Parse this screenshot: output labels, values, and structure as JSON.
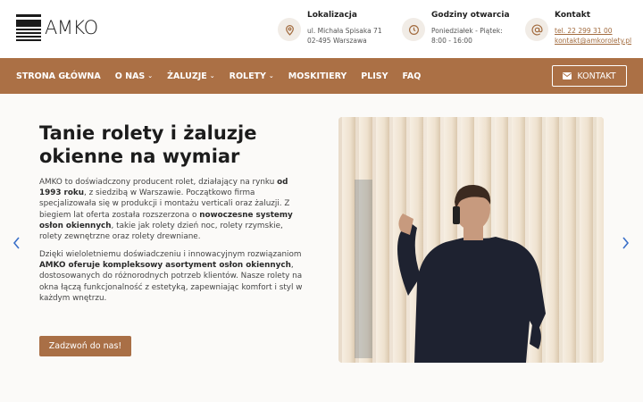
{
  "brand": {
    "name": "AMKO"
  },
  "header": {
    "location": {
      "title": "Lokalizacja",
      "line1": "ul. Michała Spisaka 71",
      "line2": "02-495 Warszawa",
      "icon": "map-pin-icon"
    },
    "hours": {
      "title": "Godziny otwarcia",
      "line1": "Poniedziałek - Piątek:",
      "line2": "8:00 - 16:00",
      "icon": "clock-icon"
    },
    "contact": {
      "title": "Kontakt",
      "phone": "tel. 22 299 31 00",
      "email": "kontakt@amkorolety.pl",
      "icon": "at-icon"
    }
  },
  "nav": {
    "items": [
      {
        "label": "STRONA GŁÓWNA",
        "dropdown": false
      },
      {
        "label": "O NAS",
        "dropdown": true
      },
      {
        "label": "ŻALUZJE",
        "dropdown": true
      },
      {
        "label": "ROLETY",
        "dropdown": true
      },
      {
        "label": "MOSKITIERY",
        "dropdown": false
      },
      {
        "label": "PLISY",
        "dropdown": false
      },
      {
        "label": "FAQ",
        "dropdown": false
      }
    ],
    "contact_button": "KONTAKT"
  },
  "hero": {
    "title": "Tanie rolety i żaluzje okienne na wymiar",
    "p1": [
      {
        "t": "AMKO to doświadczony producent rolet, działający na rynku ",
        "b": false
      },
      {
        "t": "od 1993 roku",
        "b": true
      },
      {
        "t": ", z siedzibą w Warszawie. Początkowo firma specjalizowała się w produkcji i montażu verticali oraz żaluzji. Z biegiem lat oferta została rozszerzona o ",
        "b": false
      },
      {
        "t": "nowoczesne systemy osłon okiennych",
        "b": true
      },
      {
        "t": ", takie jak rolety dzień noc, rolety rzymskie, rolety zewnętrzne oraz rolety drewniane.",
        "b": false
      }
    ],
    "p2": [
      {
        "t": "Dzięki wieloletniemu doświadczeniu i innowacyjnym rozwiązaniom ",
        "b": false
      },
      {
        "t": "AMKO oferuje kompleksowy asortyment osłon okiennych",
        "b": true
      },
      {
        "t": ", dostosowanych do różnorodnych potrzeb klientów. Nasze rolety na okna łączą funkcjonalność z estetyką, zapewniając komfort i styl w każdym wnętrzu.",
        "b": false
      }
    ],
    "cta": "Zadzwoń do nas!"
  },
  "colors": {
    "accent": "#ab7045",
    "accent_link": "#a26b3e",
    "arrow": "#3a6fc9"
  }
}
